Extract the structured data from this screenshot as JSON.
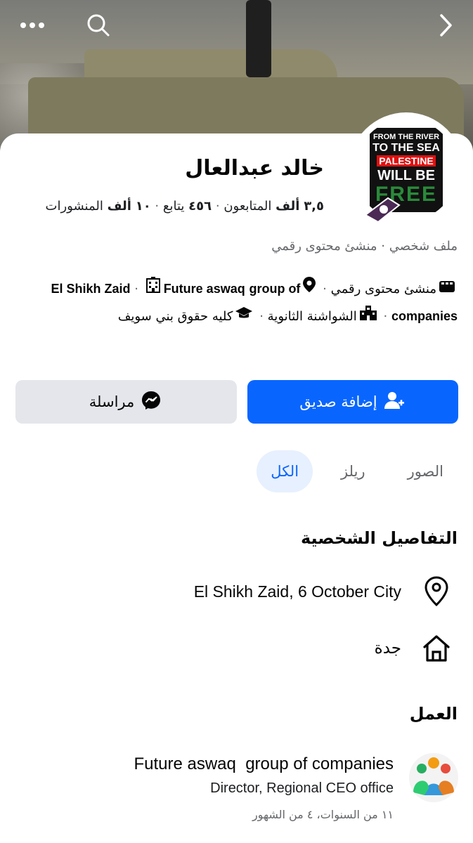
{
  "profile": {
    "name": "خالد عبدالعال",
    "stats": {
      "followers_count": "٣,٥",
      "followers_unit": "ألف",
      "followers_label": "المتابعون",
      "following_count": "٤٥٦",
      "following_label": "يتابع",
      "posts_count": "١٠",
      "posts_unit": "ألف",
      "posts_label": "المنشورات"
    },
    "role_line": "ملف شخصي · منشئ محتوى رقمي",
    "avatar_text": [
      "FROM THE RIVER",
      "TO THE SEA",
      "PALESTINE",
      "WILL BE",
      "FREE"
    ]
  },
  "details_line": {
    "creator": "منشئ محتوى رقمي",
    "location": "El Shikh Zaid",
    "work": "Future aswaq",
    "work2": "group of companies",
    "school": "الشواشنة الثانوية",
    "college": "كليه حقوق بني سويف"
  },
  "buttons": {
    "add_friend": "إضافة صديق",
    "message": "مراسلة"
  },
  "tabs": [
    "الكل",
    "ريلز",
    "الصور"
  ],
  "personal_details": {
    "title": "التفاصيل الشخصية",
    "current_city": "El Shikh Zaid, 6 October City",
    "hometown": "جدة"
  },
  "work_section": {
    "title": "العمل",
    "company": "Future aswaq  group of companies",
    "position": "Director, Regional CEO office",
    "duration": "١١ من السنوات، ٤ من الشهور"
  },
  "colors": {
    "primary": "#0866ff",
    "secondary_btn": "#e4e6eb",
    "muted_text": "#65676b",
    "active_tab_bg": "#e7f0fe"
  }
}
